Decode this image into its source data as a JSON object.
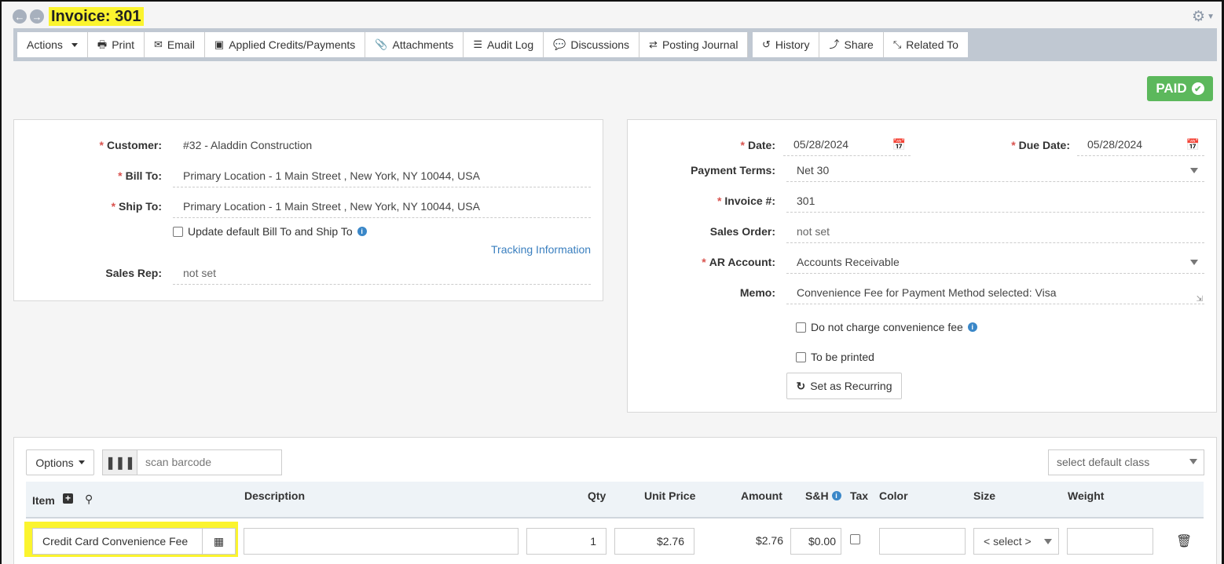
{
  "header": {
    "title": "Invoice: 301"
  },
  "toolbar": {
    "actions": "Actions",
    "print": "Print",
    "email": "Email",
    "applied": "Applied Credits/Payments",
    "attachments": "Attachments",
    "audit": "Audit Log",
    "discussions": "Discussions",
    "posting": "Posting Journal",
    "history": "History",
    "share": "Share",
    "related": "Related To"
  },
  "status": {
    "badge": "PAID",
    "color": "#5cb85c"
  },
  "left": {
    "customer_label": "Customer:",
    "customer_value": "#32 - Aladdin Construction",
    "billto_label": "Bill To:",
    "billto_value": "Primary Location - 1 Main Street , New York, NY 10044, USA",
    "shipto_label": "Ship To:",
    "shipto_value": "Primary Location - 1 Main Street , New York, NY 10044, USA",
    "update_default": "Update default Bill To and Ship To",
    "tracking": "Tracking Information",
    "salesrep_label": "Sales Rep:",
    "salesrep_value": "not set"
  },
  "right": {
    "date_label": "Date:",
    "date_value": "05/28/2024",
    "duedate_label": "Due Date:",
    "duedate_value": "05/28/2024",
    "terms_label": "Payment Terms:",
    "terms_value": "Net 30",
    "invoice_label": "Invoice #:",
    "invoice_value": "301",
    "so_label": "Sales Order:",
    "so_value": "not set",
    "ar_label": "AR Account:",
    "ar_value": "Accounts Receivable",
    "memo_label": "Memo:",
    "memo_value": "Convenience Fee for Payment Method selected: Visa",
    "no_fee": "Do not charge convenience fee",
    "to_print": "To be printed",
    "recurring": "Set as Recurring"
  },
  "lines": {
    "options": "Options",
    "barcode_placeholder": "scan barcode",
    "default_class": "select default class",
    "columns": {
      "item": "Item",
      "description": "Description",
      "qty": "Qty",
      "unit_price": "Unit Price",
      "amount": "Amount",
      "sh": "S&H",
      "tax": "Tax",
      "color": "Color",
      "size": "Size",
      "weight": "Weight"
    },
    "row": {
      "item": "Credit Card Convenience Fee",
      "description": "",
      "qty": "1",
      "unit_price": "$2.76",
      "amount": "$2.76",
      "sh": "$0.00",
      "size": "< select >"
    }
  }
}
